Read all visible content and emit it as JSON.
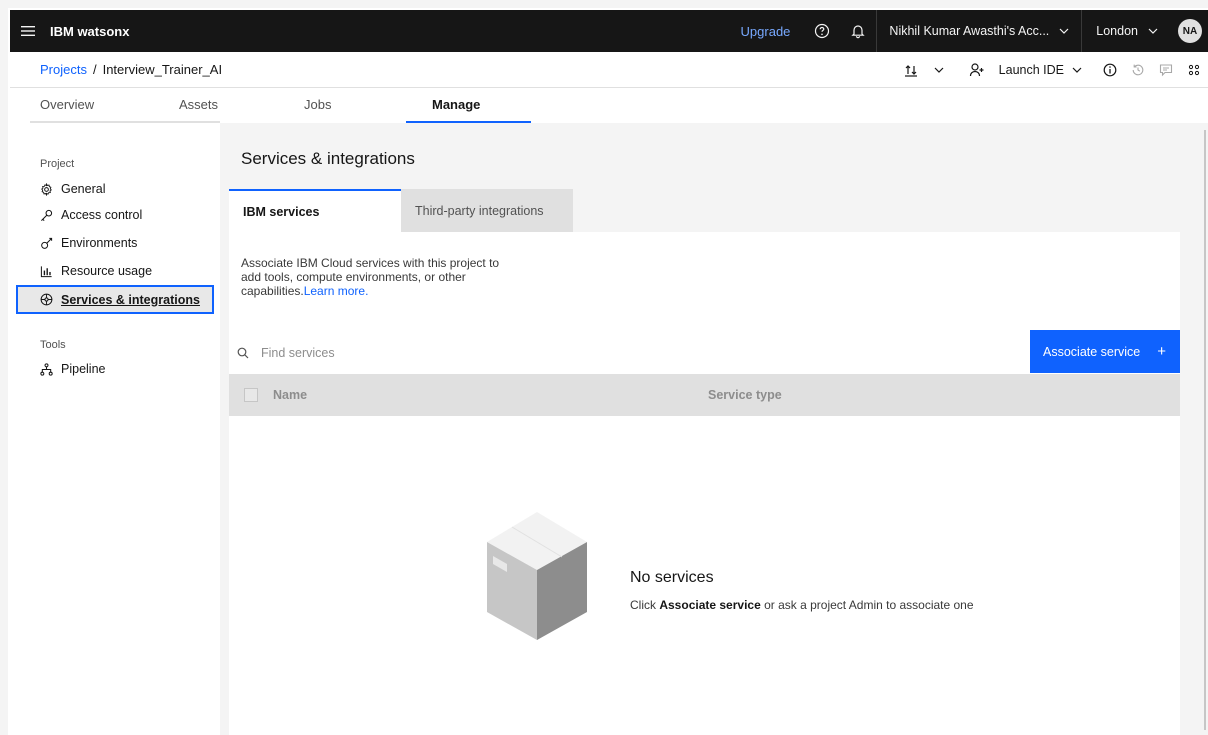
{
  "header": {
    "brand": "IBM watsonx",
    "upgrade_label": "Upgrade",
    "account_label": "Nikhil Kumar Awasthi's Acc...",
    "region_label": "London",
    "avatar_initials": "NA",
    "icons": [
      "hamburger-icon",
      "help-icon",
      "notification-icon",
      "chevron-down-icon"
    ]
  },
  "breadcrumb": {
    "root": "Projects",
    "separator": "/",
    "current": "Interview_Trainer_AI",
    "launch_ide_label": "Launch IDE"
  },
  "tabs": [
    {
      "label": "Overview",
      "active": false
    },
    {
      "label": "Assets",
      "active": false
    },
    {
      "label": "Jobs",
      "active": false
    },
    {
      "label": "Manage",
      "active": true
    }
  ],
  "sidebar": {
    "project_heading": "Project",
    "items": [
      {
        "label": "General",
        "icon": "gear-icon"
      },
      {
        "label": "Access control",
        "icon": "key-icon"
      },
      {
        "label": "Environments",
        "icon": "flask-icon"
      },
      {
        "label": "Resource usage",
        "icon": "bar-chart-icon"
      },
      {
        "label": "Services & integrations",
        "icon": "integrations-icon",
        "selected": true
      }
    ],
    "tools_heading": "Tools",
    "tools": [
      {
        "label": "Pipeline",
        "icon": "pipeline-icon"
      }
    ]
  },
  "main": {
    "title": "Services & integrations",
    "subtabs": [
      {
        "label": "IBM services",
        "active": true
      },
      {
        "label": "Third-party integrations",
        "active": false
      }
    ],
    "description": "Associate IBM Cloud services with this project to add tools, compute environments, or other capabilities.",
    "learn_more": "Learn more.",
    "search_placeholder": "Find services",
    "associate_button": "Associate service",
    "associate_button_icon": "+",
    "columns": [
      "Name",
      "Service type"
    ],
    "empty_title": "No services",
    "empty_msg_prefix": "Click ",
    "empty_msg_bold": "Associate service",
    "empty_msg_suffix": " or ask a project Admin to associate one"
  },
  "colors": {
    "accent": "#0f62fe",
    "header_bg": "#161616",
    "upgrade_link": "#78a9ff",
    "content_bg": "#f4f4f4"
  }
}
